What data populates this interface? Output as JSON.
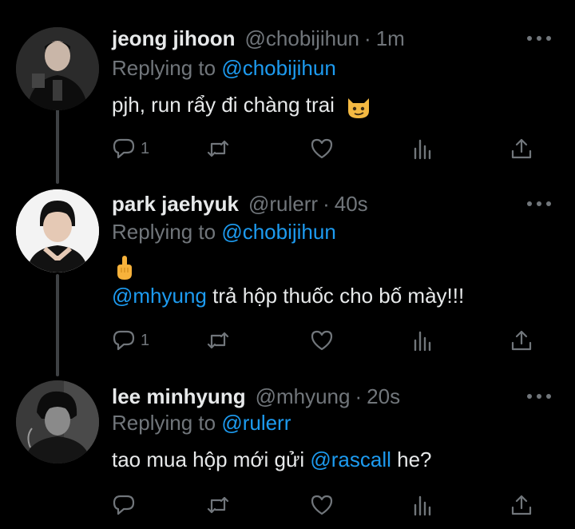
{
  "tweets": [
    {
      "name": "jeong jihoon",
      "handle": "@chobijihun",
      "separator": "·",
      "time": "1m",
      "replying_prefix": "Replying to",
      "replying_handle": "@chobijihun",
      "text": "pjh, run rẩy đi chàng trai",
      "emoji": "cat-smirk-emoji",
      "reply_count": "1"
    },
    {
      "name": "park jaehyuk",
      "handle": "@rulerr",
      "separator": "·",
      "time": "40s",
      "replying_prefix": "Replying to",
      "replying_handle": "@chobijihun",
      "emoji": "middle-finger-emoji",
      "mention": "@mhyung",
      "text_rest": " trả hộp thuốc cho bố mày!!!",
      "reply_count": "1"
    },
    {
      "name": "lee minhyung",
      "handle": "@mhyung",
      "separator": "·",
      "time": "20s",
      "replying_prefix": "Replying to",
      "replying_handle": "@rulerr",
      "text_before": "tao mua hộp mới gửi ",
      "mention": "@rascall",
      "text_after": " he?",
      "reply_count": ""
    }
  ],
  "colors": {
    "background": "#000000",
    "text": "#e7e9ea",
    "muted": "#71767b",
    "accent": "#1d9bf0",
    "thread_line": "#3e4144"
  },
  "icons": [
    "reply-icon",
    "retweet-icon",
    "like-icon",
    "analytics-icon",
    "share-icon",
    "more-icon"
  ]
}
